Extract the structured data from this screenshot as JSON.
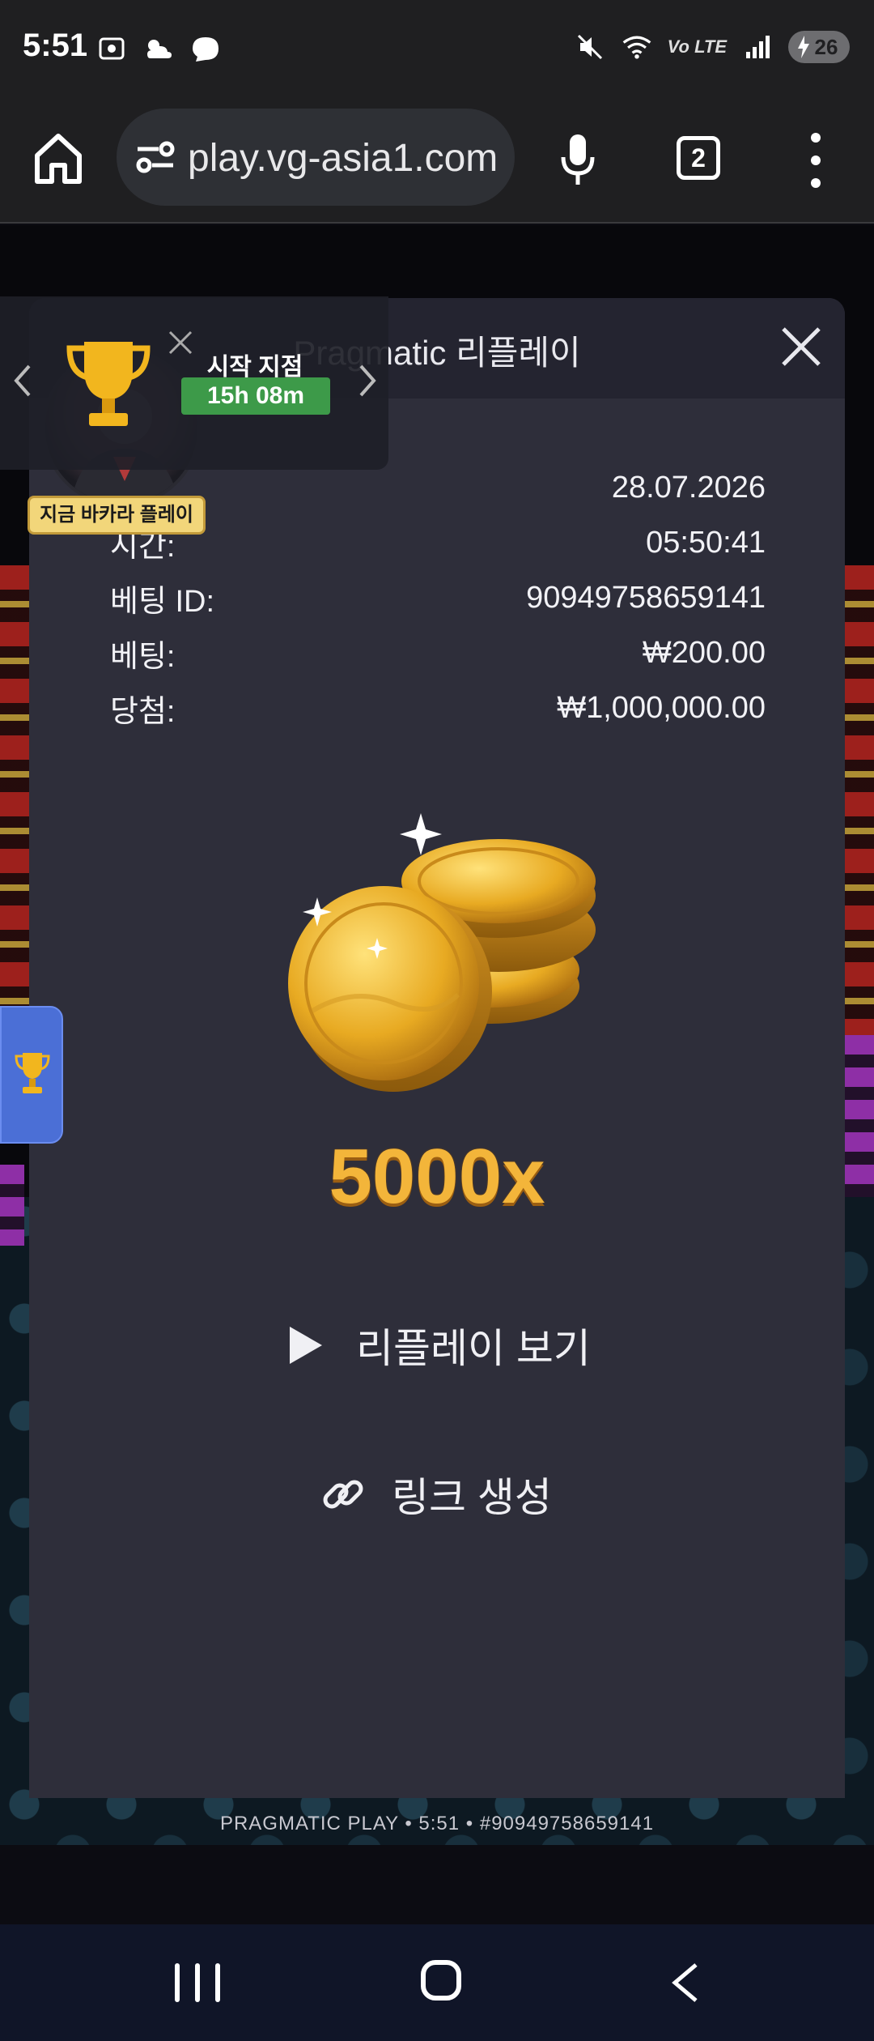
{
  "status_bar": {
    "time": "5:51",
    "network": "Vo LTE",
    "battery": "26"
  },
  "browser": {
    "url": "play.vg-asia1.com",
    "tab_count": "2"
  },
  "tournament": {
    "label": "시작 지점",
    "timer": "15h 08m",
    "play_badge": "지금 바카라 플레이"
  },
  "modal": {
    "title": "Pragmatic 리플레이",
    "rows": [
      {
        "label": "",
        "value": "28.07.2026"
      },
      {
        "label": "시간:",
        "value": "05:50:41"
      },
      {
        "label": "베팅 ID:",
        "value": "90949758659141"
      },
      {
        "label": "베팅:",
        "value": "₩200.00"
      },
      {
        "label": "당첨:",
        "value": "₩1,000,000.00"
      }
    ],
    "multiplier": "5000x",
    "replay_label": "리플레이 보기",
    "link_label": "링크 생성"
  },
  "game_footer": {
    "text": "PRAGMATIC PLAY • 5:51 • #90949758659141"
  },
  "colors": {
    "modal_bg": "#2e2e3a",
    "timer_green": "#3d9a49",
    "gold": "#f3b53a"
  }
}
